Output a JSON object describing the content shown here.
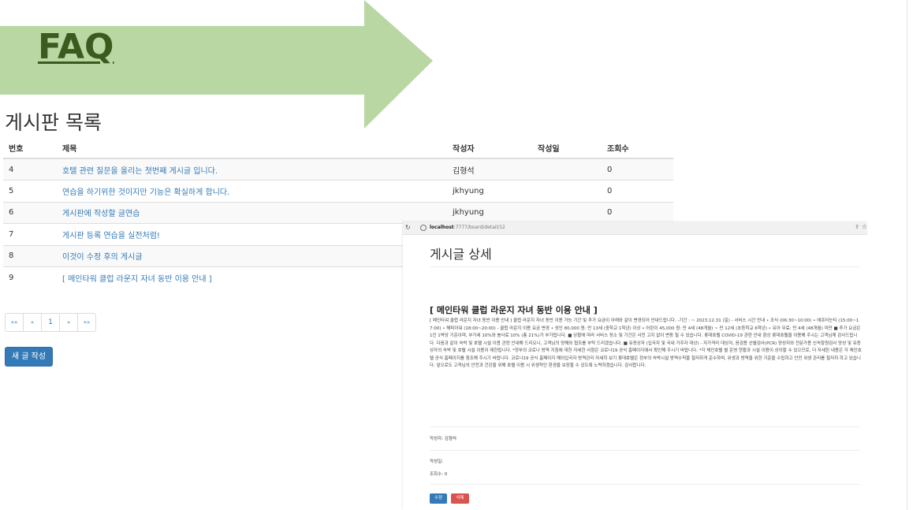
{
  "slide": {
    "title": "FAQ",
    "arrow_color": "#b8d7a3",
    "title_color": "#3a5a1e"
  },
  "board": {
    "heading": "게시판 목록",
    "columns": [
      "번호",
      "제목",
      "작성자",
      "작성일",
      "조회수"
    ],
    "rows": [
      {
        "no": "4",
        "title": "호텔 관련 질문을 올리는 첫번째 게시글 입니다.",
        "author": "김형석",
        "date": "",
        "views": "0"
      },
      {
        "no": "5",
        "title": "연습을 하기위한 것이지만 기능은 확실하게 합니다.",
        "author": "jkhyung",
        "date": "",
        "views": "0"
      },
      {
        "no": "6",
        "title": "게시판에 작성할 글연습",
        "author": "jkhyung",
        "date": "",
        "views": "0"
      },
      {
        "no": "7",
        "title": "게시판 등록 연습을 실전처럼!",
        "author": "",
        "date": "",
        "views": ""
      },
      {
        "no": "8",
        "title": "이것이 수정 후의 게시글",
        "author": "",
        "date": "",
        "views": ""
      },
      {
        "no": "9",
        "title": "[ 메인타워 클럽 라운지 자녀 동반 이용 안내 ]",
        "author": "",
        "date": "",
        "views": ""
      }
    ],
    "pagination": {
      "first": "««",
      "prev": "«",
      "current": "1",
      "next": "»",
      "last": "»»"
    },
    "new_post_label": "새 글 작성",
    "link_color": "#337ab7",
    "button_color": "#337ab7"
  },
  "detail": {
    "url_host": "localhost",
    "url_path": ":7777/board/detail/12",
    "heading": "게시글 상세",
    "post_title": "[ 메인타워 클럽 라운지 자녀 동반 이용 안내 ]",
    "body": "[ 메인타워 클럽 라운지 자녀 동반 이용 안내 ] 클럽 라운지 자녀 동반 이용 가능 기간 및 추가 요금이 아래와 같이 변경되어 안내드립니다. -기간 : ~ 2023.12.31 (일) - 서비스 시간 안내 • 조식 (06:30~10:00) • 애프터눈티 (15:00~17:00) • 해피아워 (18:00~20:00) - 클럽 라운지 이용 요금 변경 • 성인 80,000 원: 만 13세 (중학교 1학년) 이상 • 어린이 45,000 원: 만 4세 (48개월) ~ 만 12세 (초등학교 6학년) • 유아 무료: 만 4세 (48개월) 미만 ■ 추가 요금은 1인 1박당 기준이며, 부가세 10%와 봉사료 10% (총 21%)가 부가됩니다. ■ 상황에 따라 서비스 장소 및 기간은 사전 고지 없이 변동 될 수 있습니다. 롯데호텔 COVID-19 관련 안내 항상 롯데호텔을 이용해 주시는 고객님께 감사드립니다. 다음과 같이 숙박 및 호텔 시설 이용 관련 안내해 드리오니, 고객님의 양해와 협조를 부탁 드리겠습니다. ■ 유증상자 (입국자 및 국내 거주자 대상) - 자가격리 대상자, 음검용 선별검사(PCR) 양성자와 전문가용 신속항원검사 양성 및 유증상자의 숙박 및 호텔 시설 이용이 제한됩니다. *정부의 코로나 방역 지침에 대한 자세한 사항은 코로나19 공식 홈페이지에서 확인해 주시기 바랍니다. *각 체인호텔 별 운영 현황과 시설 이용이 상이할 수 있으므로, 더 자세한 내용은 각 체인호텔 공식 홈페이지를 참조해 주시기 바랍니다. 코로나19 공식 홈페이지 해외입국자 방역관리 자세히 보기 롯데호텔은 정부의 숙박시설 방역수칙을 철저하게 준수하며, 위생과 방역을 위한 기준을 수립하고 안전 위생 관리를 철저히 하고 있습니다. 앞으로도 고객님의 안전과 건강을 위해 호텔 이용 시 위생적인 환경을 보장할 수 있도록 노력하겠습니다. 감사합니다.",
    "author_line": "작성자: 김형석",
    "date_line": "작성일:",
    "views_line": "조회수: 0",
    "edit_label": "수정",
    "delete_label": "삭제",
    "edit_color": "#337ab7",
    "delete_color": "#d9534f"
  }
}
